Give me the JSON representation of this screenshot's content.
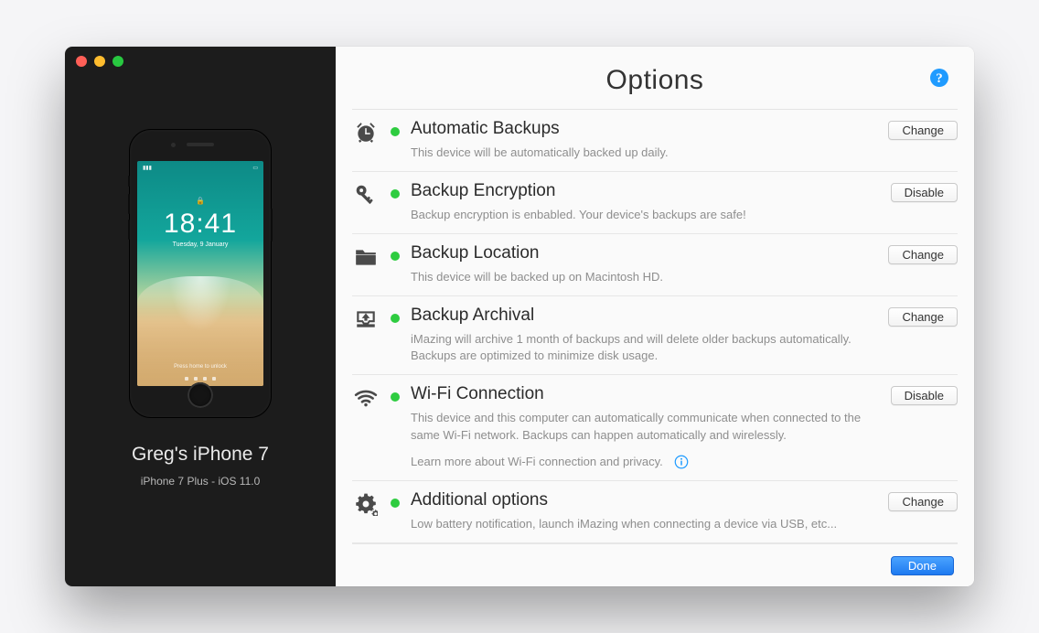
{
  "device": {
    "name": "Greg's iPhone 7",
    "model_line": "iPhone 7 Plus - iOS 11.0",
    "lock_time": "18:41",
    "lock_date": "Tuesday, 9 January"
  },
  "header": {
    "title": "Options"
  },
  "sections": [
    {
      "icon": "alarm-clock-icon",
      "title": "Automatic Backups",
      "desc": "This device will be automatically backed up daily.",
      "button": "Change"
    },
    {
      "icon": "key-icon",
      "title": "Backup Encryption",
      "desc": "Backup encryption is enbabled. Your device's backups are safe!",
      "button": "Disable"
    },
    {
      "icon": "folder-icon",
      "title": "Backup Location",
      "desc": "This device will be backed up on Macintosh HD.",
      "button": "Change"
    },
    {
      "icon": "archive-tray-icon",
      "title": "Backup Archival",
      "desc": "iMazing will archive 1 month of backups and will delete older backups automatically. Backups are optimized to minimize disk usage.",
      "button": "Change"
    },
    {
      "icon": "wifi-icon",
      "title": "Wi-Fi Connection",
      "desc": "This device and this computer can automatically communicate when connected to the same Wi-Fi network. Backups can happen automatically and wirelessly.",
      "extra": "Learn more about Wi-Fi connection and privacy.",
      "button": "Disable"
    },
    {
      "icon": "gear-icon",
      "title": "Additional options",
      "desc": "Low battery notification, launch iMazing when connecting a device via USB, etc...",
      "button": "Change"
    }
  ],
  "footer": {
    "done": "Done"
  }
}
